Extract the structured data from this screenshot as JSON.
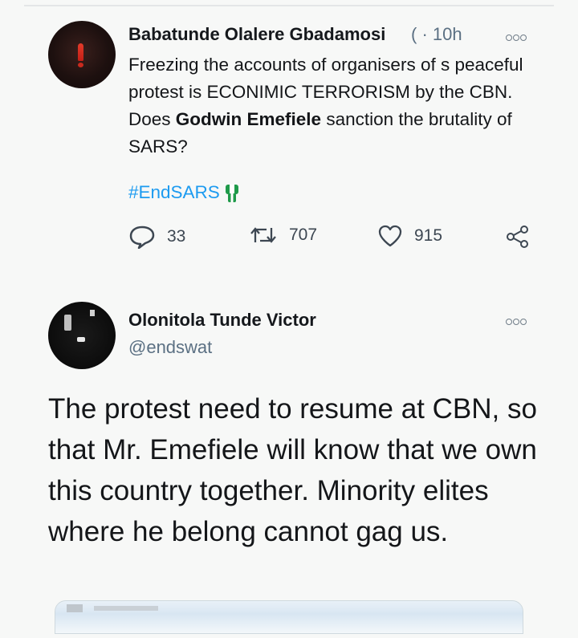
{
  "tweet1": {
    "author": "Babatunde Olalere Gbadamosi",
    "handle_fragment": "(",
    "separator": "·",
    "time": "10h",
    "text_part1": "Freezing the accounts of organisers of s peaceful protest is ECONIMIC TERRORISM by the CBN. Does ",
    "text_bold": "Godwin Emefiele",
    "text_part2": " sanction the brutality of SARS?",
    "hashtag": "#EndSARS",
    "replies": "33",
    "retweets": "707",
    "likes": "915"
  },
  "tweet2": {
    "author": "Olonitola Tunde Victor",
    "handle": "@endswat",
    "text": "The protest need to resume at CBN, so that Mr. Emefiele will know that we own this country together. Minority elites where he belong cannot gag us."
  },
  "icons": {
    "more": "more-options-icon",
    "reply": "reply-icon",
    "retweet": "retweet-icon",
    "like": "heart-icon",
    "share": "share-icon",
    "emoji": "raised-fist-emoji-icon"
  },
  "colors": {
    "hashtag": "#1d9bf0",
    "secondary_text": "#5b7083",
    "emoji_green": "#1f9a4a"
  }
}
